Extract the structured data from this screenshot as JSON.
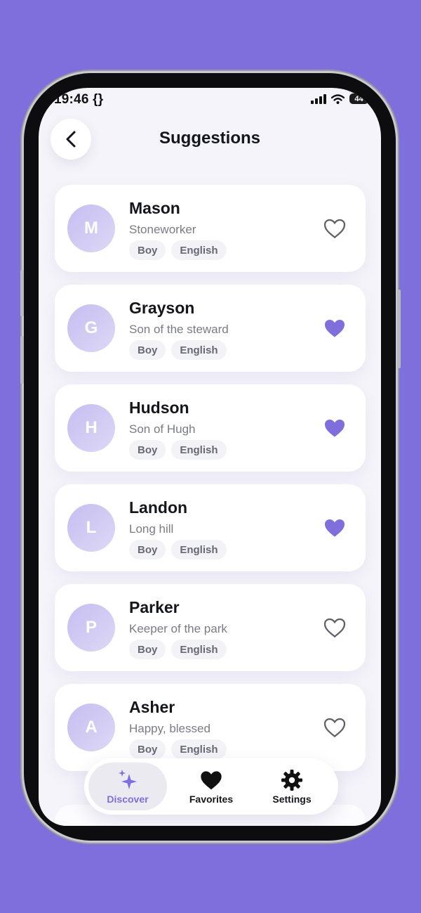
{
  "status_bar": {
    "time": "19:46 {}",
    "battery": "44"
  },
  "header": {
    "title": "Suggestions"
  },
  "colors": {
    "accent": "#7f6fdc",
    "background": "#7f6fdc"
  },
  "names": [
    {
      "initial": "M",
      "name": "Mason",
      "meaning": "Stoneworker",
      "tags": [
        "Boy",
        "English"
      ],
      "favorited": false
    },
    {
      "initial": "G",
      "name": "Grayson",
      "meaning": "Son of the steward",
      "tags": [
        "Boy",
        "English"
      ],
      "favorited": true
    },
    {
      "initial": "H",
      "name": "Hudson",
      "meaning": "Son of Hugh",
      "tags": [
        "Boy",
        "English"
      ],
      "favorited": true
    },
    {
      "initial": "L",
      "name": "Landon",
      "meaning": "Long hill",
      "tags": [
        "Boy",
        "English"
      ],
      "favorited": true
    },
    {
      "initial": "P",
      "name": "Parker",
      "meaning": "Keeper of the park",
      "tags": [
        "Boy",
        "English"
      ],
      "favorited": false
    },
    {
      "initial": "A",
      "name": "Asher",
      "meaning": "Happy, blessed",
      "tags": [
        "Boy",
        "English"
      ],
      "favorited": false
    }
  ],
  "tab_bar": {
    "items": [
      {
        "label": "Discover",
        "icon": "sparkles-icon",
        "active": true
      },
      {
        "label": "Favorites",
        "icon": "heart-icon",
        "active": false
      },
      {
        "label": "Settings",
        "icon": "gear-icon",
        "active": false
      }
    ]
  }
}
